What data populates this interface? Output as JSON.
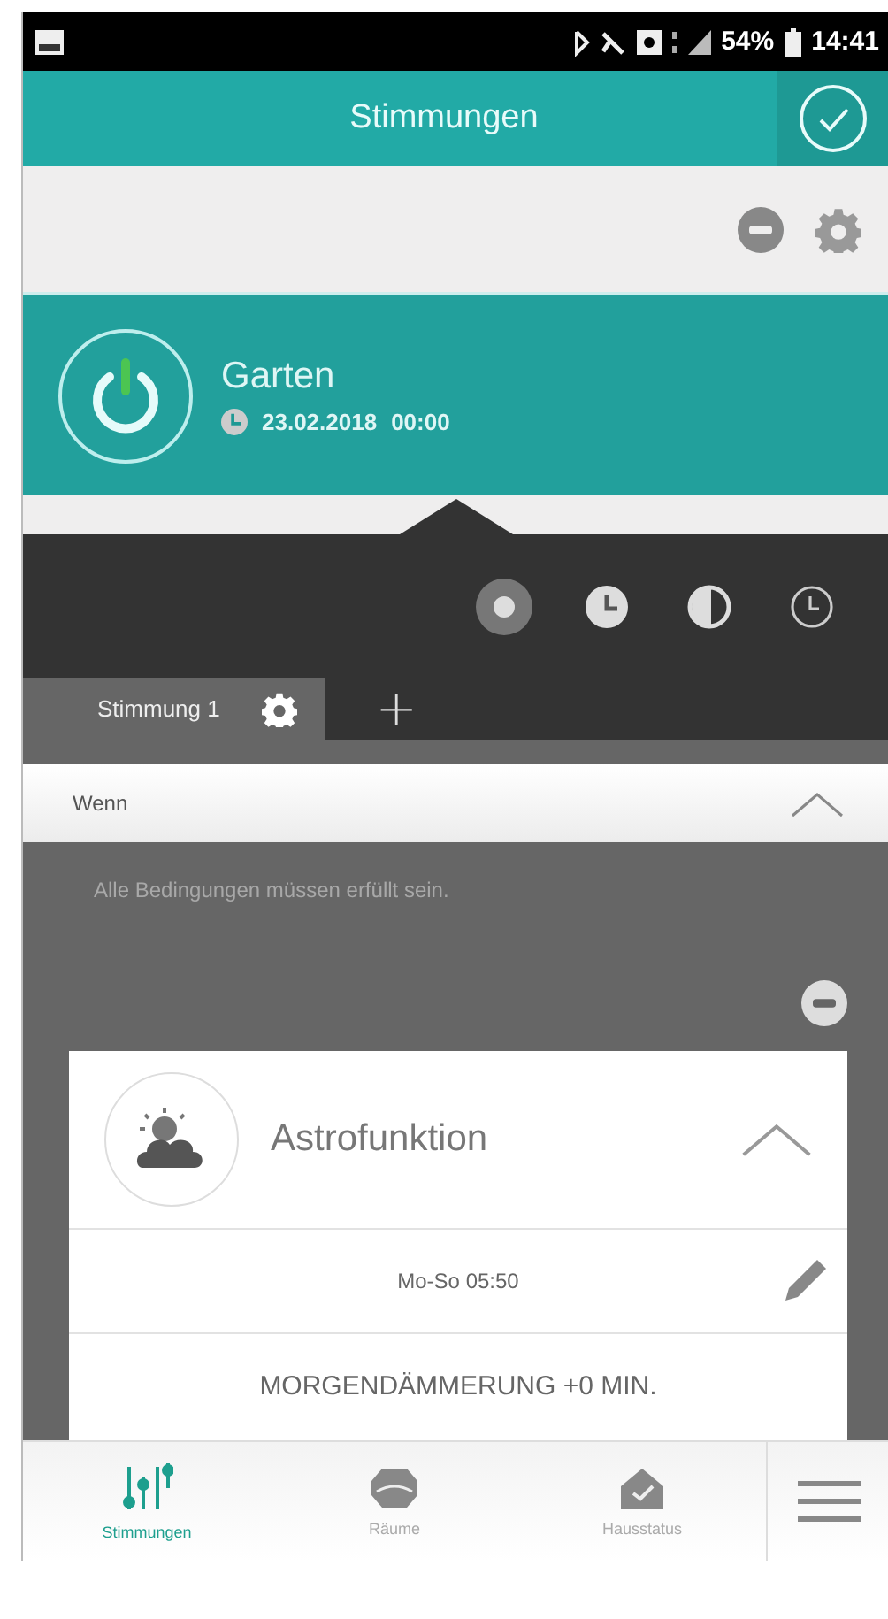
{
  "status_bar": {
    "battery": "54%",
    "time": "14:41"
  },
  "header": {
    "title": "Stimmungen"
  },
  "scene": {
    "name": "Garten",
    "date": "23.02.2018",
    "time": "00:00",
    "on": true
  },
  "modes": [
    {
      "kind": "dot",
      "selected": true
    },
    {
      "kind": "clock",
      "selected": false
    },
    {
      "kind": "moon",
      "selected": false
    },
    {
      "kind": "clock-outline",
      "selected": false
    }
  ],
  "tabs": [
    {
      "label": "Stimmung 1",
      "selected": true
    }
  ],
  "add_tab": "+",
  "section": {
    "title": "Wenn",
    "expanded": true,
    "hint": "Alle Bedingungen müssen erfüllt sein."
  },
  "condition": {
    "title": "Astrofunktion",
    "expanded": true,
    "schedule": "Mo-So 05:50",
    "event": "MORGENDÄMMERUNG +0 MIN."
  },
  "nav": [
    {
      "kind": "sliders",
      "label": "Stimmungen",
      "selected": true
    },
    {
      "kind": "rooms",
      "label": "Räume",
      "selected": false
    },
    {
      "kind": "house",
      "label": "Hausstatus",
      "selected": false
    }
  ]
}
